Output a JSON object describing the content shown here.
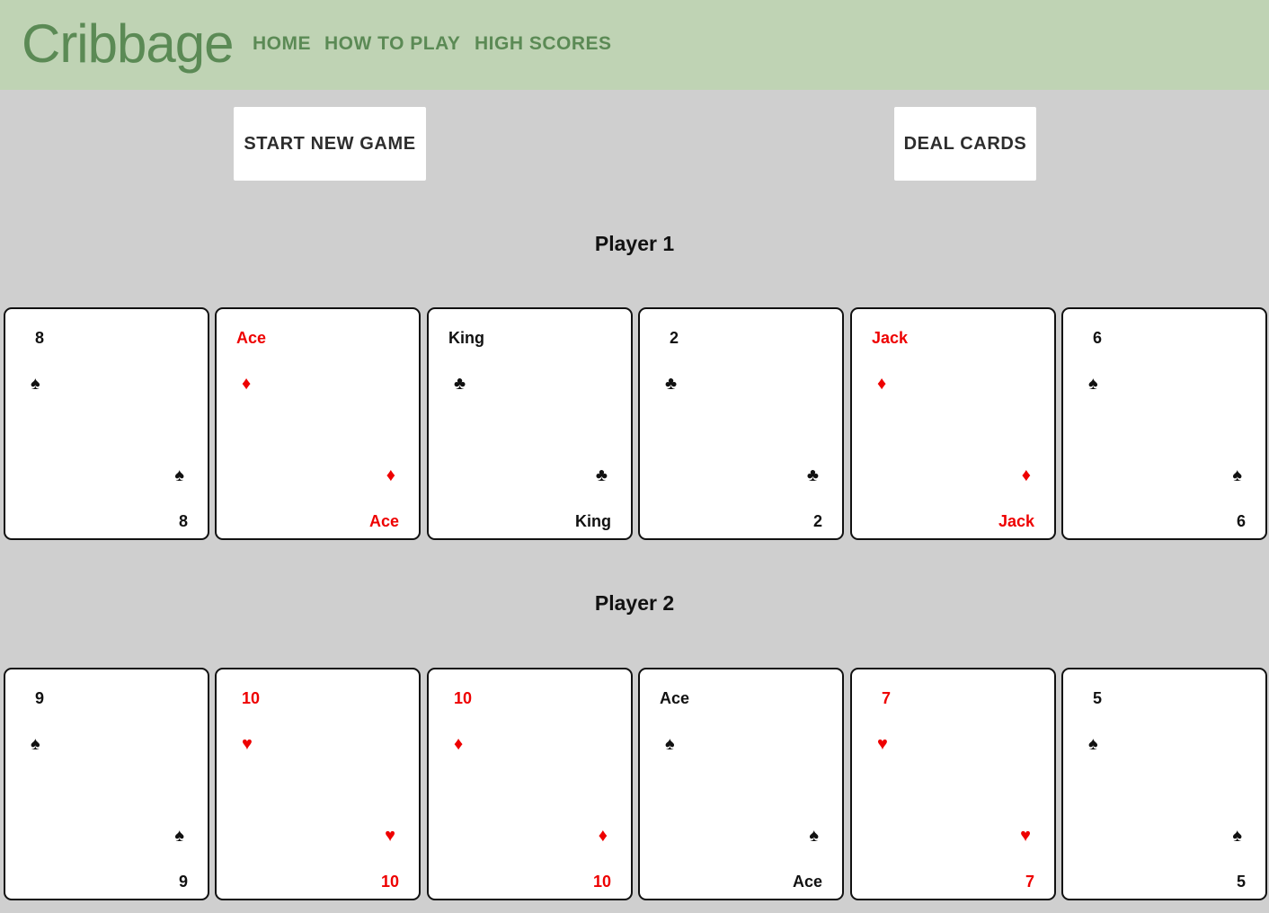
{
  "app": {
    "title": "Cribbage",
    "nav": [
      {
        "label": "HOME"
      },
      {
        "label": "HOW TO PLAY"
      },
      {
        "label": "HIGH SCORES"
      }
    ]
  },
  "actions": {
    "start_new_game": "START NEW GAME",
    "deal_cards": "DEAL CARDS"
  },
  "colors": {
    "header_bg": "#bfd3b4",
    "brand_green": "#5b8a55",
    "table_bg": "#cfcfcf",
    "red_suit": "#ee0000",
    "black_suit": "#111111"
  },
  "players": [
    {
      "name": "Player 1",
      "cards": [
        {
          "rank": "8",
          "suit": "♠",
          "suit_name": "spades-icon",
          "color": "black"
        },
        {
          "rank": "Ace",
          "suit": "♦",
          "suit_name": "diamonds-icon",
          "color": "red"
        },
        {
          "rank": "King",
          "suit": "♣",
          "suit_name": "clubs-icon",
          "color": "black"
        },
        {
          "rank": "2",
          "suit": "♣",
          "suit_name": "clubs-icon",
          "color": "black"
        },
        {
          "rank": "Jack",
          "suit": "♦",
          "suit_name": "diamonds-icon",
          "color": "red"
        },
        {
          "rank": "6",
          "suit": "♠",
          "suit_name": "spades-icon",
          "color": "black"
        }
      ]
    },
    {
      "name": "Player 2",
      "cards": [
        {
          "rank": "9",
          "suit": "♠",
          "suit_name": "spades-icon",
          "color": "black"
        },
        {
          "rank": "10",
          "suit": "♥",
          "suit_name": "hearts-icon",
          "color": "red"
        },
        {
          "rank": "10",
          "suit": "♦",
          "suit_name": "diamonds-icon",
          "color": "red"
        },
        {
          "rank": "Ace",
          "suit": "♠",
          "suit_name": "spades-icon",
          "color": "black"
        },
        {
          "rank": "7",
          "suit": "♥",
          "suit_name": "hearts-icon",
          "color": "red"
        },
        {
          "rank": "5",
          "suit": "♠",
          "suit_name": "spades-icon",
          "color": "black"
        }
      ]
    }
  ]
}
